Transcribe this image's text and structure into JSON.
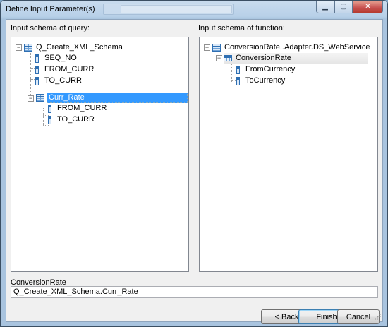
{
  "window": {
    "title": "Define Input Parameter(s)"
  },
  "left_panel": {
    "label": "Input schema of query:",
    "tree": {
      "root": "Q_Create_XML_Schema",
      "root_children": [
        "SEQ_NO",
        "FROM_CURR",
        "TO_CURR"
      ],
      "nested": "Curr_Rate",
      "nested_children": [
        "FROM_CURR",
        "TO_CURR"
      ],
      "selected": "Curr_Rate"
    }
  },
  "right_panel": {
    "label": "Input schema of function:",
    "tree": {
      "root": "ConversionRate..Adapter.DS_WebService",
      "nested": "ConversionRate",
      "nested_children": [
        "FromCurrency",
        "ToCurrency"
      ]
    }
  },
  "selection_field": {
    "label": "ConversionRate",
    "value": "Q_Create_XML_Schema.Curr_Rate"
  },
  "buttons": {
    "back": "< Back",
    "finish": "Finish",
    "cancel": "Cancel"
  },
  "colors": {
    "selection": "#3399ff",
    "tree_icon": "#2f6fb2"
  }
}
